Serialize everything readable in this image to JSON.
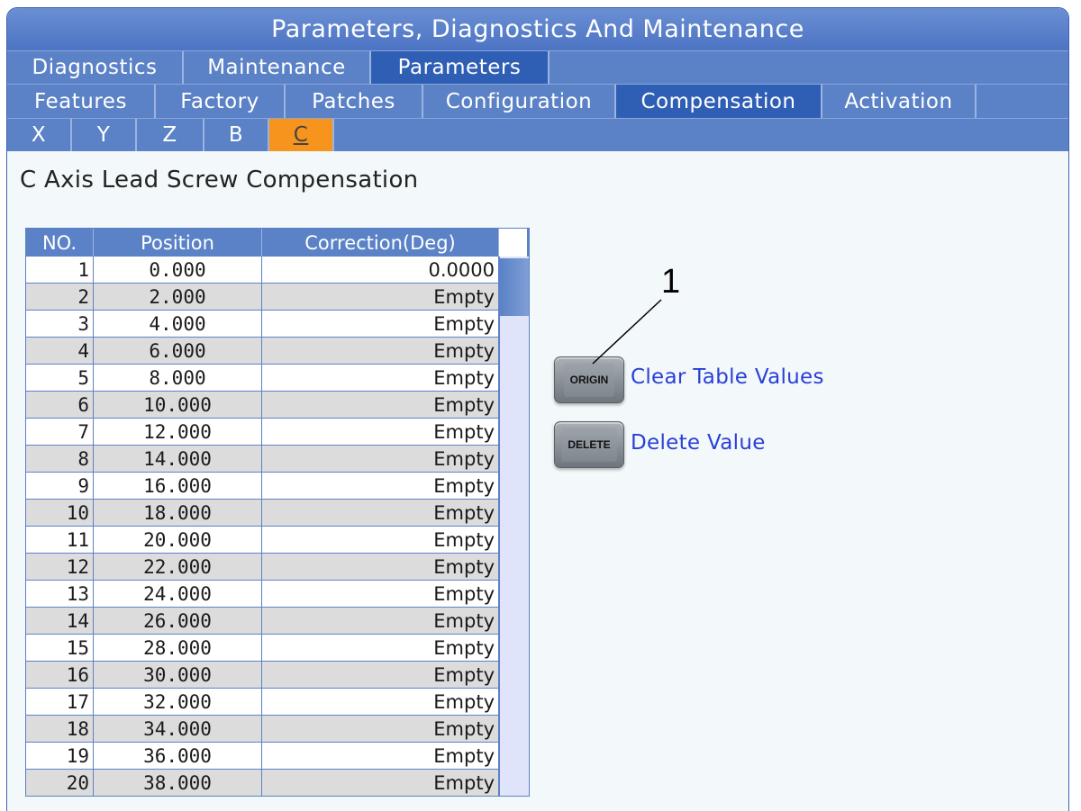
{
  "window": {
    "title": "Parameters, Diagnostics And Maintenance"
  },
  "tabs_row1": [
    "Diagnostics",
    "Maintenance",
    "Parameters"
  ],
  "tabs_row2": [
    "Features",
    "Factory",
    "Patches",
    "Configuration",
    "Compensation",
    "Activation"
  ],
  "tabs_row3": [
    "X",
    "Y",
    "Z",
    "B",
    "C"
  ],
  "page_title": "C Axis Lead Screw Compensation",
  "table": {
    "headers": [
      "NO.",
      "Position",
      "Correction(Deg)"
    ],
    "rows": [
      [
        "1",
        "0.000",
        "0.0000"
      ],
      [
        "2",
        "2.000",
        "Empty"
      ],
      [
        "3",
        "4.000",
        "Empty"
      ],
      [
        "4",
        "6.000",
        "Empty"
      ],
      [
        "5",
        "8.000",
        "Empty"
      ],
      [
        "6",
        "10.000",
        "Empty"
      ],
      [
        "7",
        "12.000",
        "Empty"
      ],
      [
        "8",
        "14.000",
        "Empty"
      ],
      [
        "9",
        "16.000",
        "Empty"
      ],
      [
        "10",
        "18.000",
        "Empty"
      ],
      [
        "11",
        "20.000",
        "Empty"
      ],
      [
        "12",
        "22.000",
        "Empty"
      ],
      [
        "13",
        "24.000",
        "Empty"
      ],
      [
        "14",
        "26.000",
        "Empty"
      ],
      [
        "15",
        "28.000",
        "Empty"
      ],
      [
        "16",
        "30.000",
        "Empty"
      ],
      [
        "17",
        "32.000",
        "Empty"
      ],
      [
        "18",
        "34.000",
        "Empty"
      ],
      [
        "19",
        "36.000",
        "Empty"
      ],
      [
        "20",
        "38.000",
        "Empty"
      ]
    ]
  },
  "actions": {
    "origin_key": "ORIGIN",
    "origin_label": "Clear Table Values",
    "delete_key": "DELETE",
    "delete_label": "Delete Value"
  },
  "callout": "1",
  "colors": {
    "tab_bg": "#5b82c6",
    "tab_active": "#2f5fb5",
    "axis_active": "#f7941d",
    "action_text": "#2a3fd6"
  }
}
